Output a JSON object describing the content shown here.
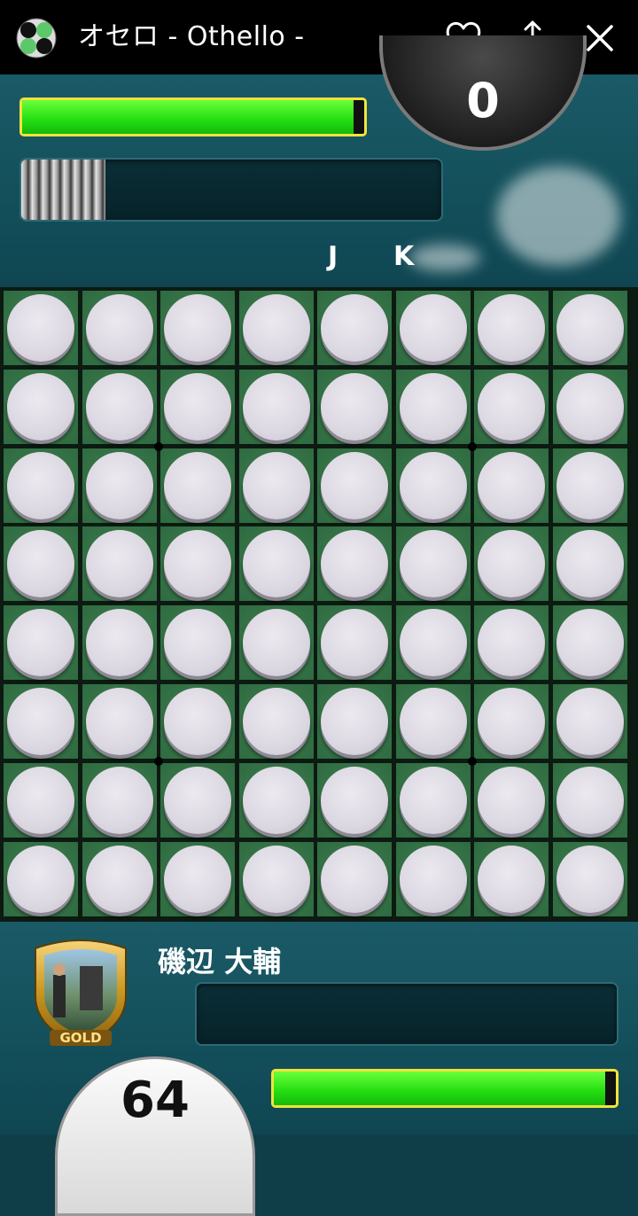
{
  "app_bar": {
    "title": "オセロ - Othello -",
    "icons": [
      "othello-logo-icon",
      "heart-icon",
      "share-icon",
      "close-icon"
    ]
  },
  "opponent": {
    "score": "0",
    "hp_fraction": 0.97,
    "timer_fraction": 0.2,
    "name_visible_letters": [
      "J",
      "K"
    ]
  },
  "board": {
    "rows": 8,
    "cols": 8,
    "cells": [
      [
        "white",
        "white",
        "white",
        "white",
        "white",
        "white",
        "white",
        "white"
      ],
      [
        "white",
        "white",
        "white",
        "white",
        "white",
        "white",
        "white",
        "white"
      ],
      [
        "white",
        "white",
        "white",
        "white",
        "white",
        "white",
        "white",
        "white"
      ],
      [
        "white",
        "white",
        "white",
        "white",
        "white",
        "white",
        "white",
        "white"
      ],
      [
        "white",
        "white",
        "white",
        "white",
        "white",
        "white",
        "white",
        "white"
      ],
      [
        "white",
        "white",
        "white",
        "white",
        "white",
        "white",
        "white",
        "white"
      ],
      [
        "white",
        "white",
        "white",
        "white",
        "white",
        "white",
        "white",
        "white"
      ],
      [
        "white",
        "white",
        "white",
        "white",
        "white",
        "white",
        "white",
        "white"
      ]
    ]
  },
  "player": {
    "name": "磯辺 大輔",
    "rank_badge": "GOLD",
    "score": "64",
    "hp_fraction": 0.97,
    "timer_fraction": 0
  },
  "colors": {
    "hp_green": "#22dd11",
    "hp_border": "#f0e43a",
    "board_green": "#2f6a40",
    "disc_white": "#dcd8e2",
    "panel_teal": "#13505c"
  }
}
